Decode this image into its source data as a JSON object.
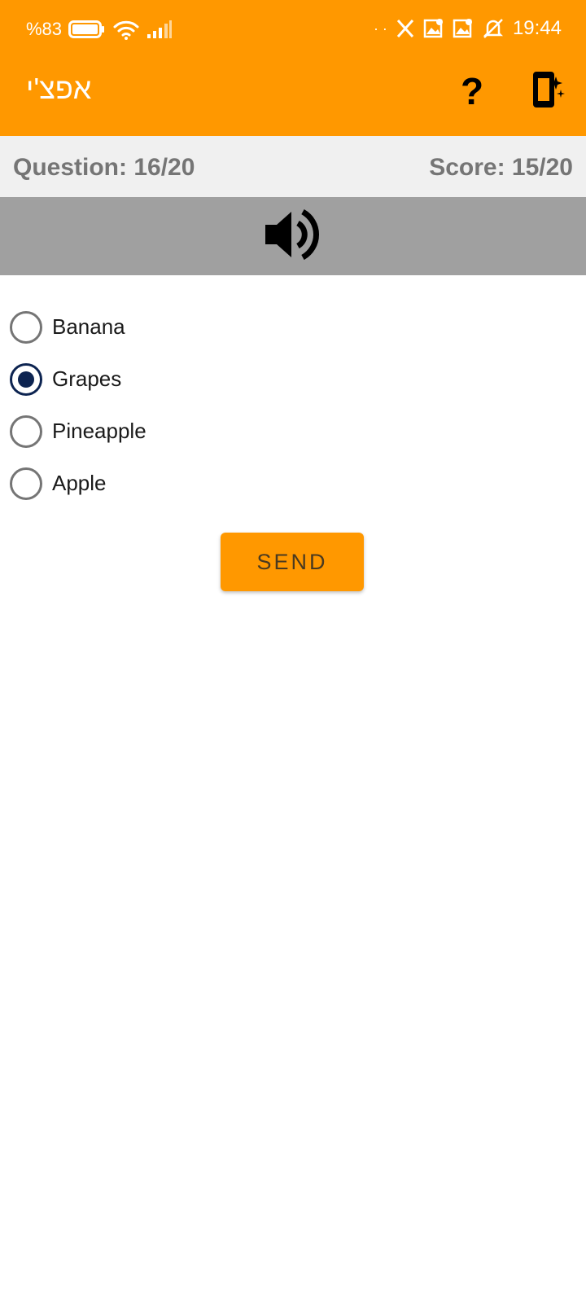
{
  "status_bar": {
    "battery_text": "%83",
    "time": "19:44",
    "dots": "· ·",
    "background_color": "#FF9800"
  },
  "app_bar": {
    "title": "אפצ'י",
    "help_label": "?",
    "background_color": "#FF9800"
  },
  "info": {
    "question": "Question: 16/20",
    "score": "Score: 15/20"
  },
  "audio": {
    "icon": "speaker-volume-icon"
  },
  "options": [
    {
      "label": "Banana",
      "selected": false
    },
    {
      "label": "Grapes",
      "selected": true
    },
    {
      "label": "Pineapple",
      "selected": false
    },
    {
      "label": "Apple",
      "selected": false
    }
  ],
  "send_button": {
    "label": "SEND",
    "color": "#FF9800"
  },
  "colors": {
    "radio_selected": "#0D2451",
    "radio_unselected": "#757575",
    "info_text": "#757575"
  }
}
